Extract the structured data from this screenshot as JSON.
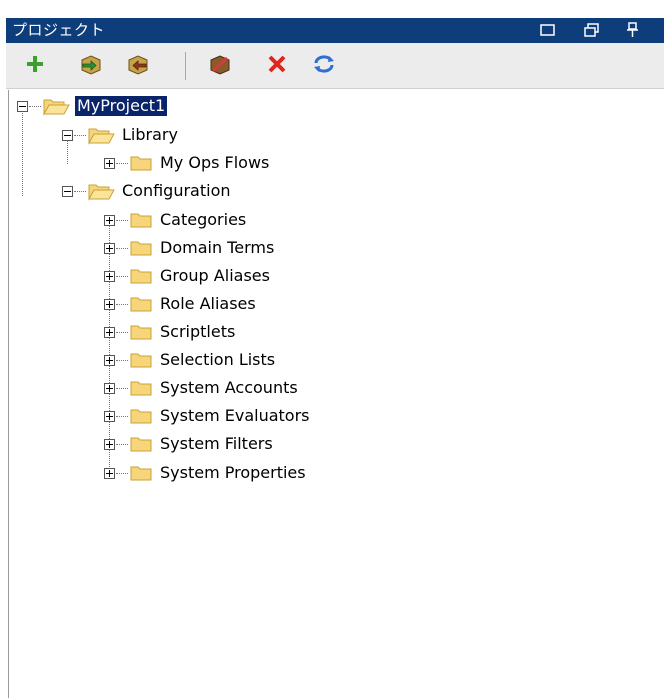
{
  "window": {
    "title": "プロジェクト",
    "controls": {
      "minimize": "minimize-icon",
      "restore": "restore-icon",
      "pin": "pin-icon"
    }
  },
  "toolbar": {
    "buttons": [
      {
        "icon": "add-icon",
        "color": "#3aa12c"
      },
      {
        "icon": "import-icon",
        "color": "#c8a24a"
      },
      {
        "icon": "export-icon",
        "color": "#c8a24a"
      },
      {
        "icon": "edit-icon",
        "color": "#8a5a2b"
      },
      {
        "icon": "delete-icon",
        "color": "#e0261c"
      },
      {
        "icon": "refresh-icon",
        "color": "#2d6fd2"
      }
    ]
  },
  "tree": {
    "root": {
      "label": "MyProject1",
      "selected": true
    },
    "library": {
      "label": "Library",
      "children": [
        "My Ops Flows"
      ]
    },
    "configuration": {
      "label": "Configuration",
      "children": [
        "Categories",
        "Domain Terms",
        "Group Aliases",
        "Role Aliases",
        "Scriptlets",
        "Selection Lists",
        "System Accounts",
        "System Evaluators",
        "System Filters",
        "System Properties"
      ]
    }
  },
  "colors": {
    "titlebar": "#0d3d7a",
    "selection": "#0a246a",
    "folder_fill": "#f7d57a",
    "folder_stroke": "#c9a235"
  }
}
